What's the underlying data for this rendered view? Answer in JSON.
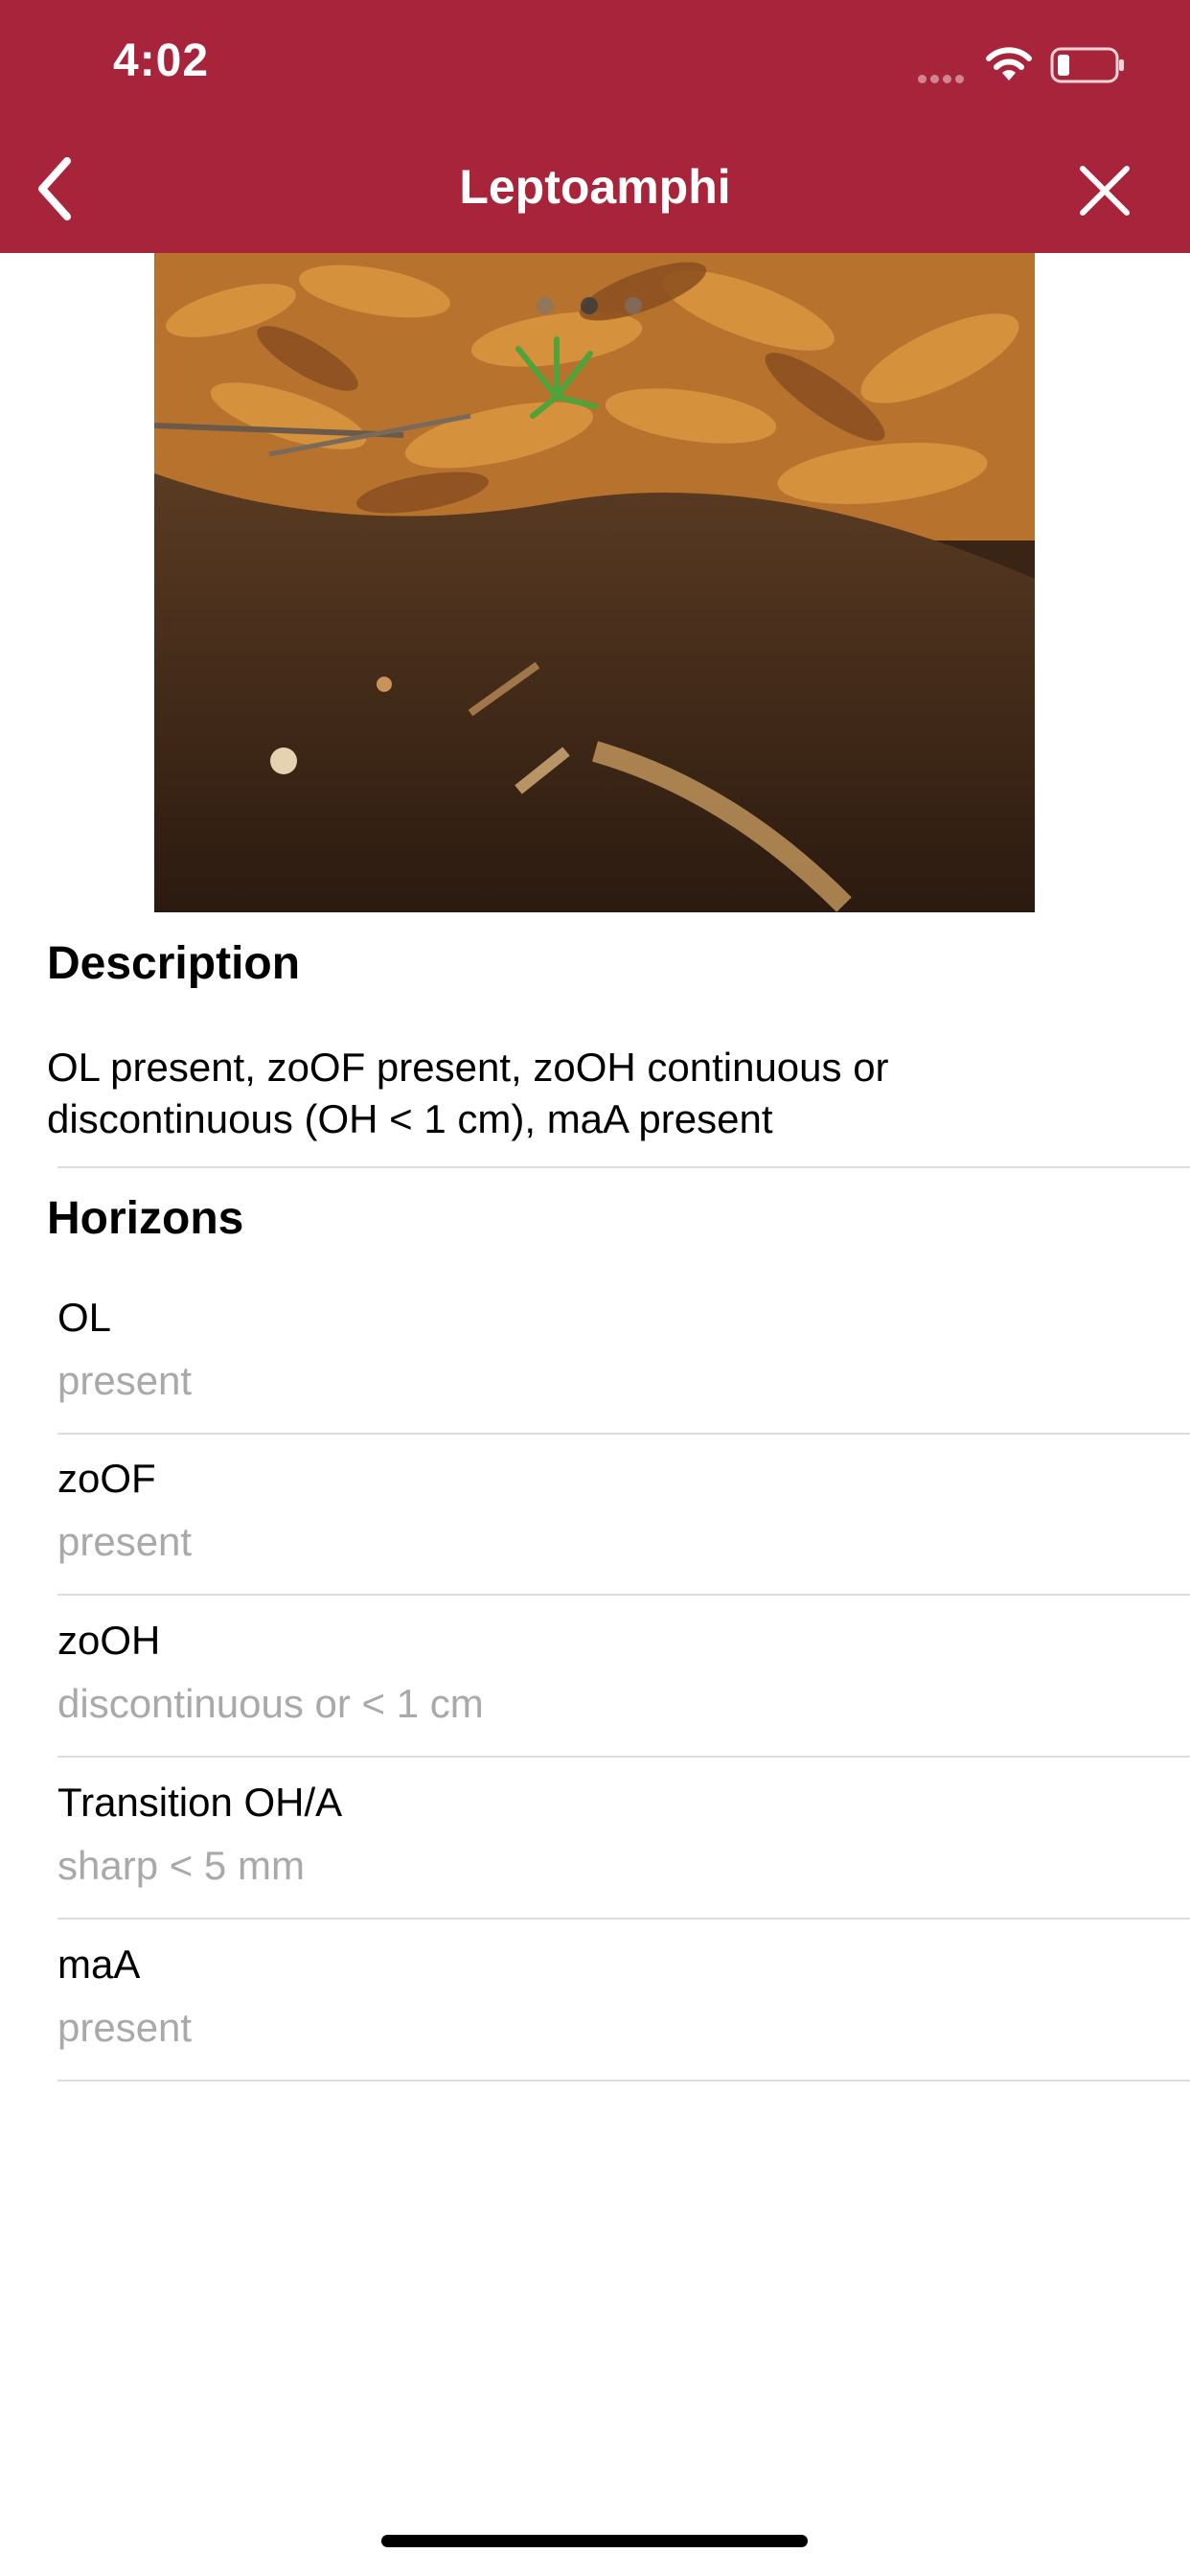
{
  "status_bar": {
    "time": "4:02"
  },
  "nav": {
    "title": "Leptoamphi"
  },
  "photo": {
    "page_count": 3,
    "active_page_index": 1
  },
  "description": {
    "heading": "Description",
    "text": "OL present, zoOF present, zoOH continuous or discontinuous (OH < 1 cm), maA present"
  },
  "horizons": {
    "heading": "Horizons",
    "items": [
      {
        "label": "OL",
        "value": "present"
      },
      {
        "label": "zoOF",
        "value": "present"
      },
      {
        "label": "zoOH",
        "value": "discontinuous or < 1 cm"
      },
      {
        "label": "Transition OH/A",
        "value": "sharp < 5 mm"
      },
      {
        "label": "maA",
        "value": "present"
      }
    ]
  },
  "colors": {
    "header": "#A8243A",
    "secondary_text": "#A9A9A9",
    "separator": "#DCDCDC"
  }
}
